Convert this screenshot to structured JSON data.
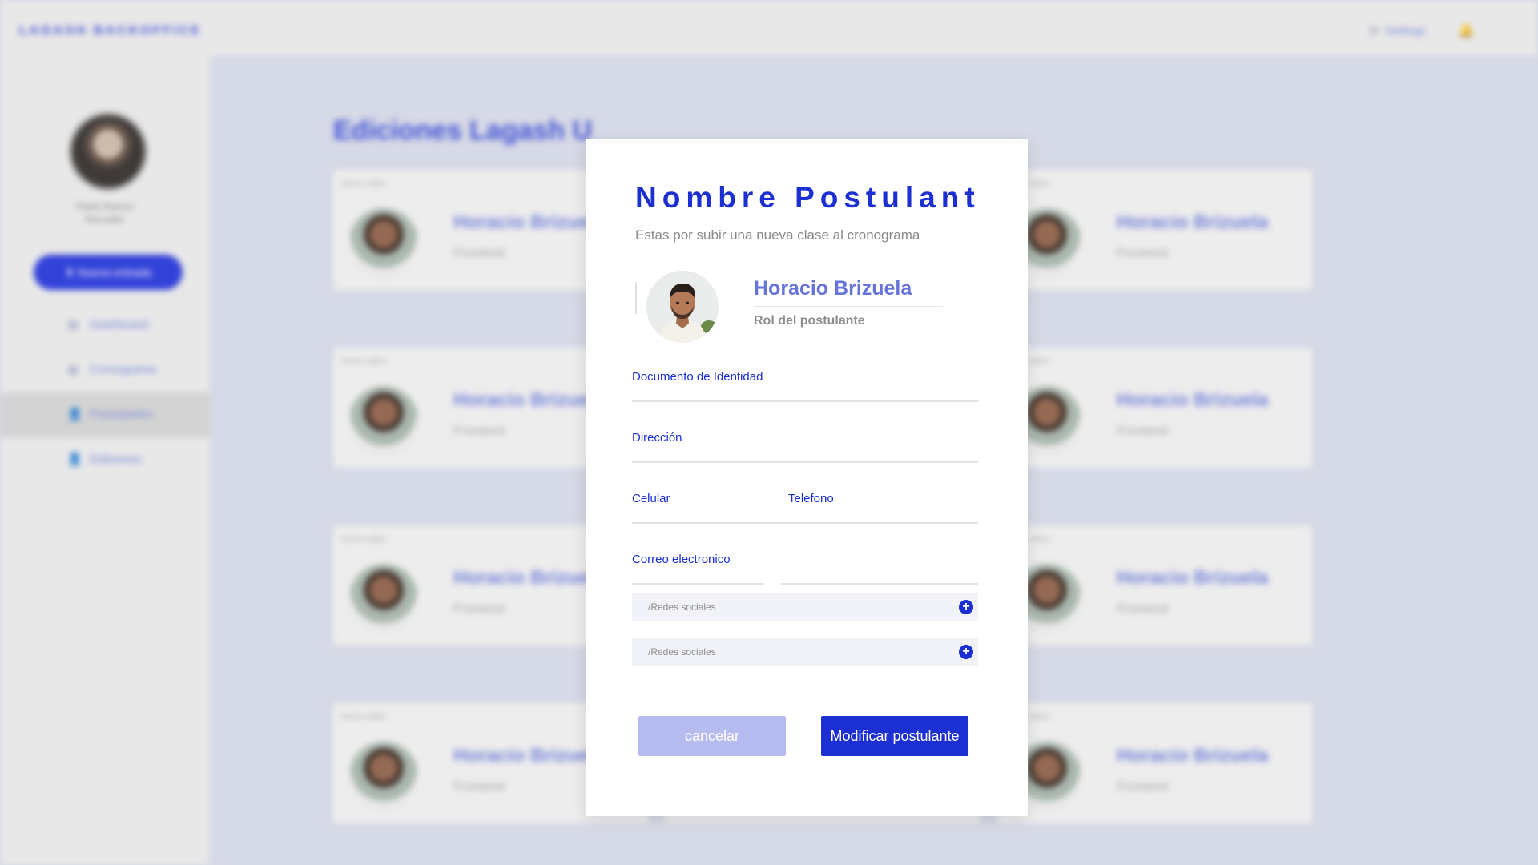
{
  "app": {
    "brand": "LAGASH BACKOFFICE",
    "settings_label": "Settings",
    "page_title": "Ediciones Lagash U"
  },
  "sidebar": {
    "user_name": "Pablo Ramos",
    "user_role": "Recruiter",
    "cta_label": "Nueva entrada",
    "items": [
      {
        "label": "Dashboard",
        "icon": "chart-icon"
      },
      {
        "label": "Cronograma",
        "icon": "calendar-icon"
      },
      {
        "label": "Postulantes",
        "icon": "user-icon",
        "active": true
      },
      {
        "label": "Ediciones",
        "icon": "user-icon"
      }
    ]
  },
  "cards": {
    "tag": "Nuevo editor",
    "name": "Horacio Brizuela",
    "role": "Frontend"
  },
  "modal": {
    "title": "Nombre Postulant",
    "subtitle": "Estas por subir una nueva clase al cronograma",
    "profile": {
      "name": "Horacio Brizuela",
      "role": "Rol del postulante"
    },
    "fields": {
      "documento": "Documento de Identidad",
      "direccion": "Dirección",
      "celular": "Celular",
      "telefono": "Telefono",
      "correo": "Correo electronico"
    },
    "social_placeholder": "/Redes sociales",
    "cancel_label": "cancelar",
    "save_label": "Modificar postulante"
  },
  "colors": {
    "accent": "#1b2fd3",
    "accent_light": "#b7bcf0",
    "name_purple": "#6673d8"
  }
}
